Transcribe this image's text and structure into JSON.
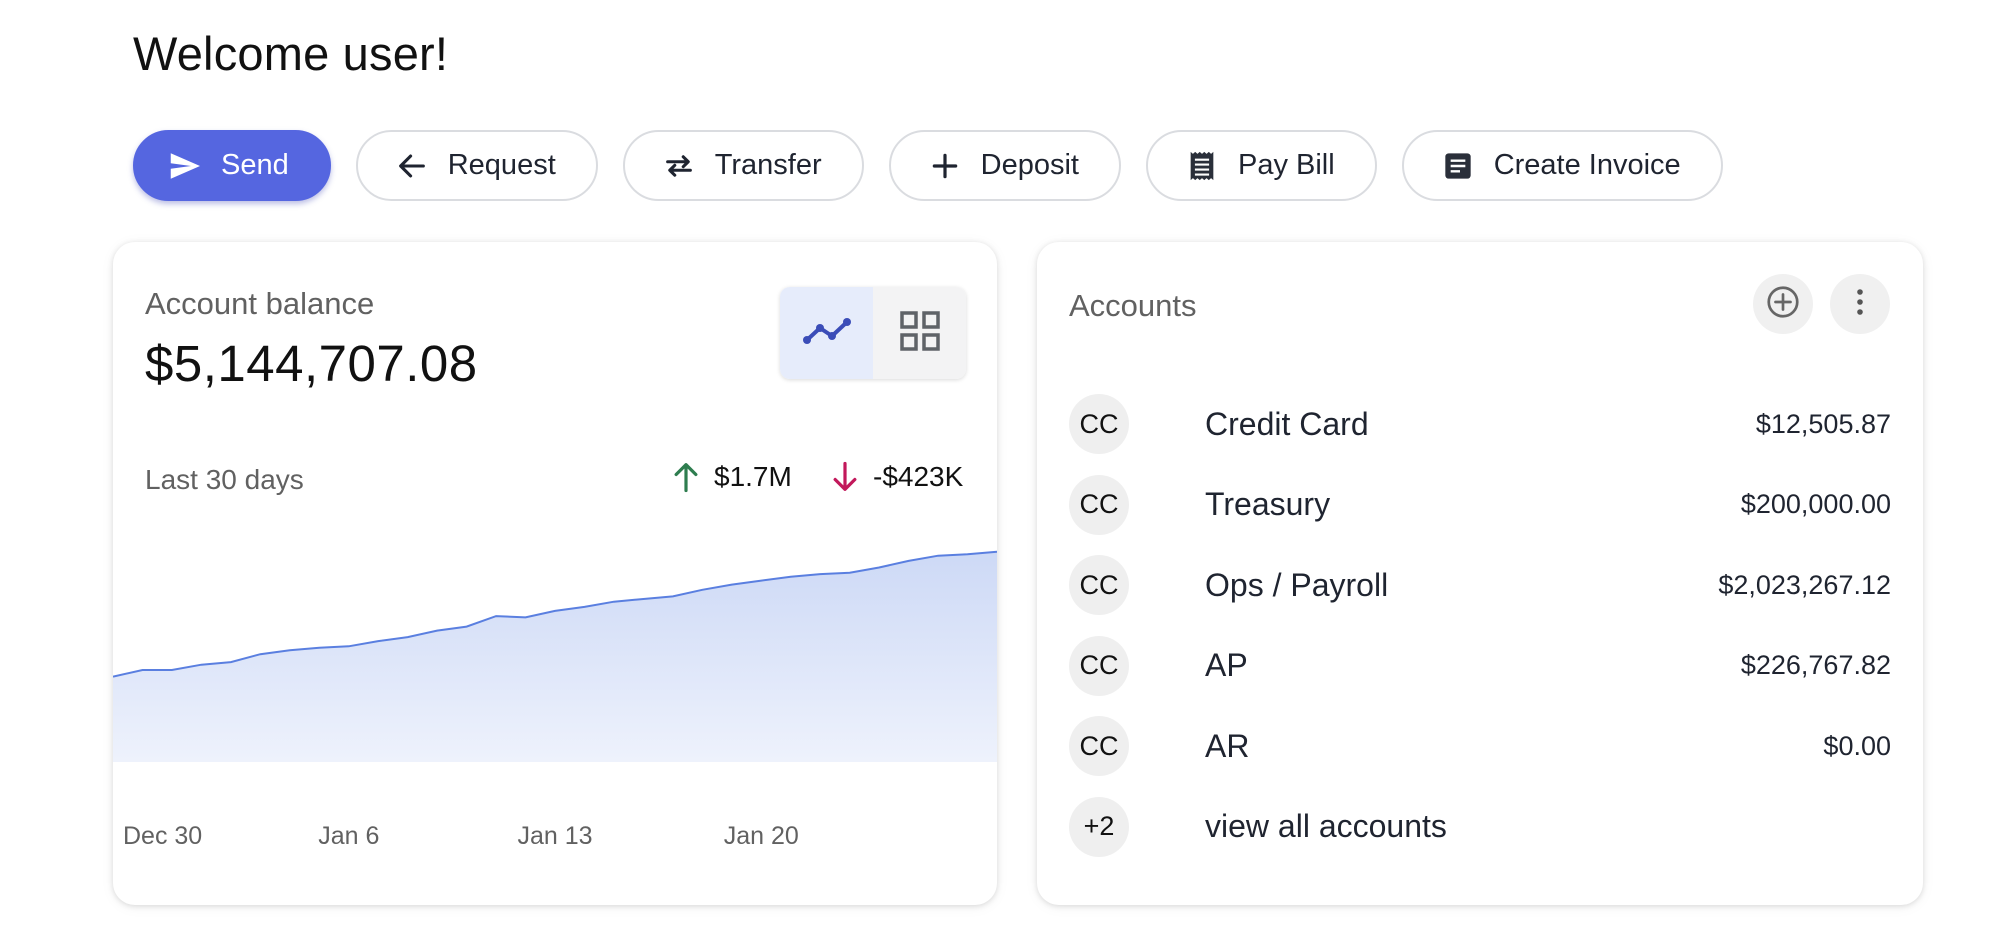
{
  "header": {
    "welcome": "Welcome user!"
  },
  "actions": [
    {
      "label": "Send",
      "icon": "send-icon",
      "primary": true
    },
    {
      "label": "Request",
      "icon": "arrow-left-icon"
    },
    {
      "label": "Transfer",
      "icon": "swap-icon"
    },
    {
      "label": "Deposit",
      "icon": "plus-icon"
    },
    {
      "label": "Pay Bill",
      "icon": "receipt-icon"
    },
    {
      "label": "Create Invoice",
      "icon": "document-icon"
    }
  ],
  "balance": {
    "label": "Account balance",
    "amount": "$5,144,707.08",
    "view_toggle": {
      "options": [
        "line-chart-icon",
        "grid-icon"
      ],
      "selected": "line-chart-icon"
    },
    "period": "Last 30 days",
    "inflow": "$1.7M",
    "outflow": "-$423K"
  },
  "chart_data": {
    "type": "area",
    "x_ticks": [
      "Dec 30",
      "Jan 6",
      "Jan 13",
      "Jan 20"
    ],
    "x": [
      "Dec 29",
      "Dec 30",
      "Dec 31",
      "Jan 1",
      "Jan 2",
      "Jan 3",
      "Jan 4",
      "Jan 5",
      "Jan 6",
      "Jan 7",
      "Jan 8",
      "Jan 9",
      "Jan 10",
      "Jan 11",
      "Jan 12",
      "Jan 13",
      "Jan 14",
      "Jan 15",
      "Jan 16",
      "Jan 17",
      "Jan 18",
      "Jan 19",
      "Jan 20",
      "Jan 21",
      "Jan 22",
      "Jan 23",
      "Jan 24",
      "Jan 25",
      "Jan 26",
      "Jan 27",
      "Jan 28"
    ],
    "values": [
      3.9,
      3.95,
      3.95,
      3.99,
      4.01,
      4.07,
      4.1,
      4.12,
      4.13,
      4.17,
      4.2,
      4.25,
      4.28,
      4.36,
      4.35,
      4.4,
      4.43,
      4.47,
      4.49,
      4.51,
      4.56,
      4.6,
      4.63,
      4.66,
      4.68,
      4.69,
      4.73,
      4.78,
      4.82,
      4.83,
      4.85
    ],
    "units": "$M (estimated)",
    "y_axis_shown": false,
    "grid": false,
    "colors": {
      "line": "#5a7fe0",
      "fill_top": "#cdd9f6",
      "fill_bottom": "#eef2fc"
    }
  },
  "accounts": {
    "title": "Accounts",
    "items": [
      {
        "avatar": "CC",
        "name": "Credit Card",
        "amount": "$12,505.87"
      },
      {
        "avatar": "CC",
        "name": "Treasury",
        "amount": "$200,000.00"
      },
      {
        "avatar": "CC",
        "name": "Ops / Payroll",
        "amount": "$2,023,267.12"
      },
      {
        "avatar": "CC",
        "name": "AP",
        "amount": "$226,767.82"
      },
      {
        "avatar": "CC",
        "name": "AR",
        "amount": "$0.00"
      }
    ],
    "more": {
      "avatar": "+2",
      "label": "view all accounts"
    }
  },
  "colors": {
    "primary": "#5566e0",
    "up": "#2e7d4f",
    "down": "#c2185b"
  }
}
